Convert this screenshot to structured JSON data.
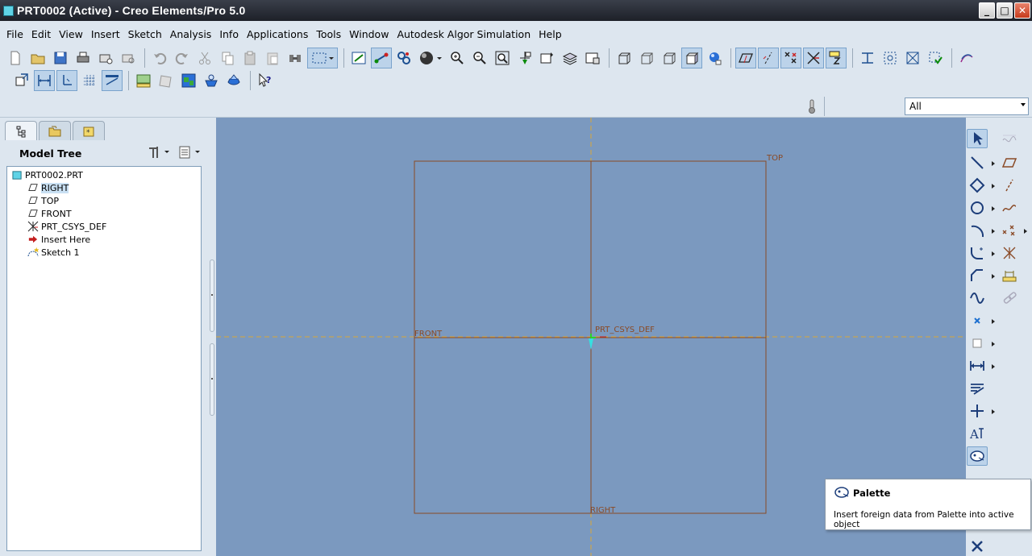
{
  "window": {
    "title": "PRT0002 (Active) - Creo Elements/Pro 5.0",
    "controls": [
      "_",
      "□",
      "✕"
    ]
  },
  "menu": [
    "File",
    "Edit",
    "View",
    "Insert",
    "Sketch",
    "Analysis",
    "Info",
    "Applications",
    "Tools",
    "Window",
    "Autodesk Algor Simulation",
    "Help"
  ],
  "filter": {
    "selected": "All"
  },
  "model_tree": {
    "title": "Model Tree",
    "items": [
      {
        "label": "PRT0002.PRT",
        "icon": "part-icon",
        "selected": false
      },
      {
        "label": "RIGHT",
        "icon": "datum-plane-icon",
        "selected": true
      },
      {
        "label": "TOP",
        "icon": "datum-plane-icon",
        "selected": false
      },
      {
        "label": "FRONT",
        "icon": "datum-plane-icon",
        "selected": false
      },
      {
        "label": "PRT_CSYS_DEF",
        "icon": "csys-icon",
        "selected": false
      },
      {
        "label": "Insert Here",
        "icon": "insert-arrow-icon",
        "selected": false
      },
      {
        "label": "Sketch 1",
        "icon": "sketch-icon",
        "selected": false
      }
    ]
  },
  "canvas": {
    "labels": {
      "top": "TOP",
      "front": "FRONT",
      "csys": "PRT_CSYS_DEF",
      "right": "RIGHT"
    },
    "colors": {
      "background": "#7b99bf",
      "datum": "#8a4a26",
      "center_line": "#d9a83a"
    }
  },
  "tooltip": {
    "title": "Palette",
    "description": "Insert foreign data from Palette into active object"
  }
}
